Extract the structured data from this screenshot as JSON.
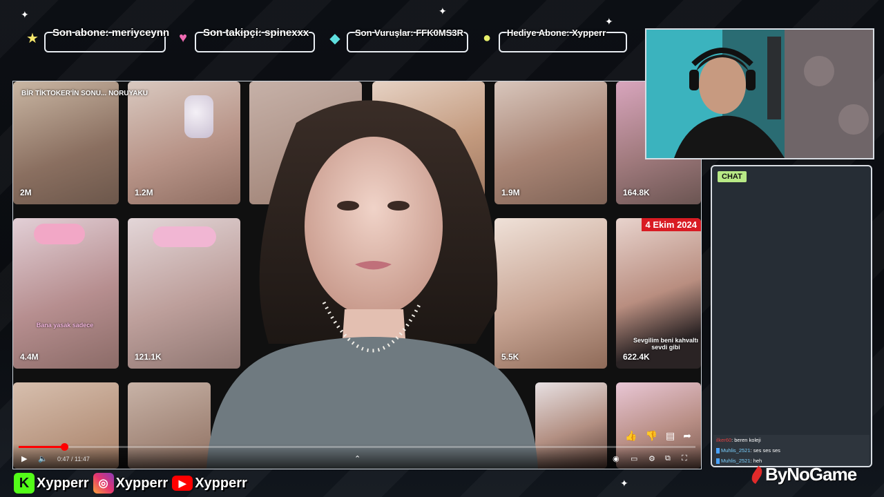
{
  "alerts": {
    "last_subscriber": "Son abone: meriyceynn",
    "last_follower": "Son takipçi: spinexxx",
    "last_hit": "Son Vuruşlar: FFK0MS3R",
    "gift_sub": "Hediye Abone: Xypperr"
  },
  "video": {
    "title": "BİR TİKTOKER'İN SONU... NORUYAKU",
    "time": "0:47 / 11:47",
    "progress": 0.067,
    "date_badge": "4 Ekim 2024",
    "view_counts": [
      "2M",
      "1.2M",
      "1.9M",
      "164.8K",
      "4.4M",
      "121.1K",
      "5.5K",
      "622.4K"
    ],
    "captions": {
      "c1": "Sevgilim beni kahvaltı sevdi gibi",
      "c2": "Bana yasak sadece"
    }
  },
  "chat": {
    "header": "CHAT",
    "messages": [
      {
        "user": "ilker60",
        "text": ": beren koleji"
      },
      {
        "user": "Muhlis_2521",
        "text": ": ses ses ses"
      },
      {
        "user": "Muhlis_2521",
        "text": ": heh"
      }
    ]
  },
  "socials": {
    "kick": "Xypperr",
    "instagram": "Xypperr",
    "youtube": "Xypperr"
  },
  "brand": "ByNoGame",
  "colors": {
    "kick_green": "#53fc18",
    "youtube_red": "#ff0000",
    "chat_badge": "#b8e986",
    "date_badge": "#d91b23"
  }
}
